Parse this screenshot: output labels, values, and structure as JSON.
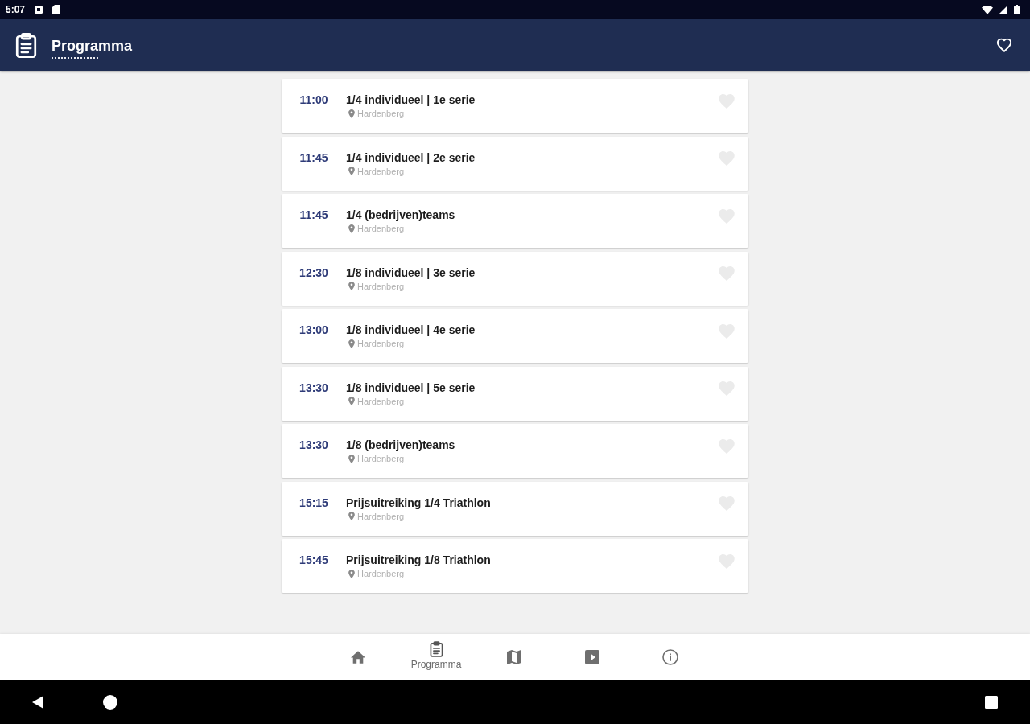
{
  "status_bar": {
    "time": "5:07"
  },
  "app_bar": {
    "title": "Programma"
  },
  "events": [
    {
      "time": "11:00",
      "title": "1/4 individueel | 1e serie",
      "location": "Hardenberg",
      "favorite": false
    },
    {
      "time": "11:45",
      "title": "1/4 individueel | 2e serie",
      "location": "Hardenberg",
      "favorite": false
    },
    {
      "time": "11:45",
      "title": "1/4 (bedrijven)teams",
      "location": "Hardenberg",
      "favorite": false
    },
    {
      "time": "12:30",
      "title": "1/8 individueel | 3e serie",
      "location": "Hardenberg",
      "favorite": false
    },
    {
      "time": "13:00",
      "title": "1/8 individueel | 4e serie",
      "location": "Hardenberg",
      "favorite": false
    },
    {
      "time": "13:30",
      "title": "1/8 individueel | 5e serie",
      "location": "Hardenberg",
      "favorite": false
    },
    {
      "time": "13:30",
      "title": "1/8 (bedrijven)teams",
      "location": "Hardenberg",
      "favorite": false
    },
    {
      "time": "15:15",
      "title": "Prijsuitreiking 1/4 Triathlon",
      "location": "Hardenberg",
      "favorite": false
    },
    {
      "time": "15:45",
      "title": "Prijsuitreiking 1/8 Triathlon",
      "location": "Hardenberg",
      "favorite": false
    }
  ],
  "bottom_nav": [
    {
      "kind": "home",
      "selected": false
    },
    {
      "kind": "programma",
      "selected": true,
      "label": "Programma"
    },
    {
      "kind": "map",
      "selected": false
    },
    {
      "kind": "video",
      "selected": false
    },
    {
      "kind": "info",
      "selected": false
    }
  ]
}
